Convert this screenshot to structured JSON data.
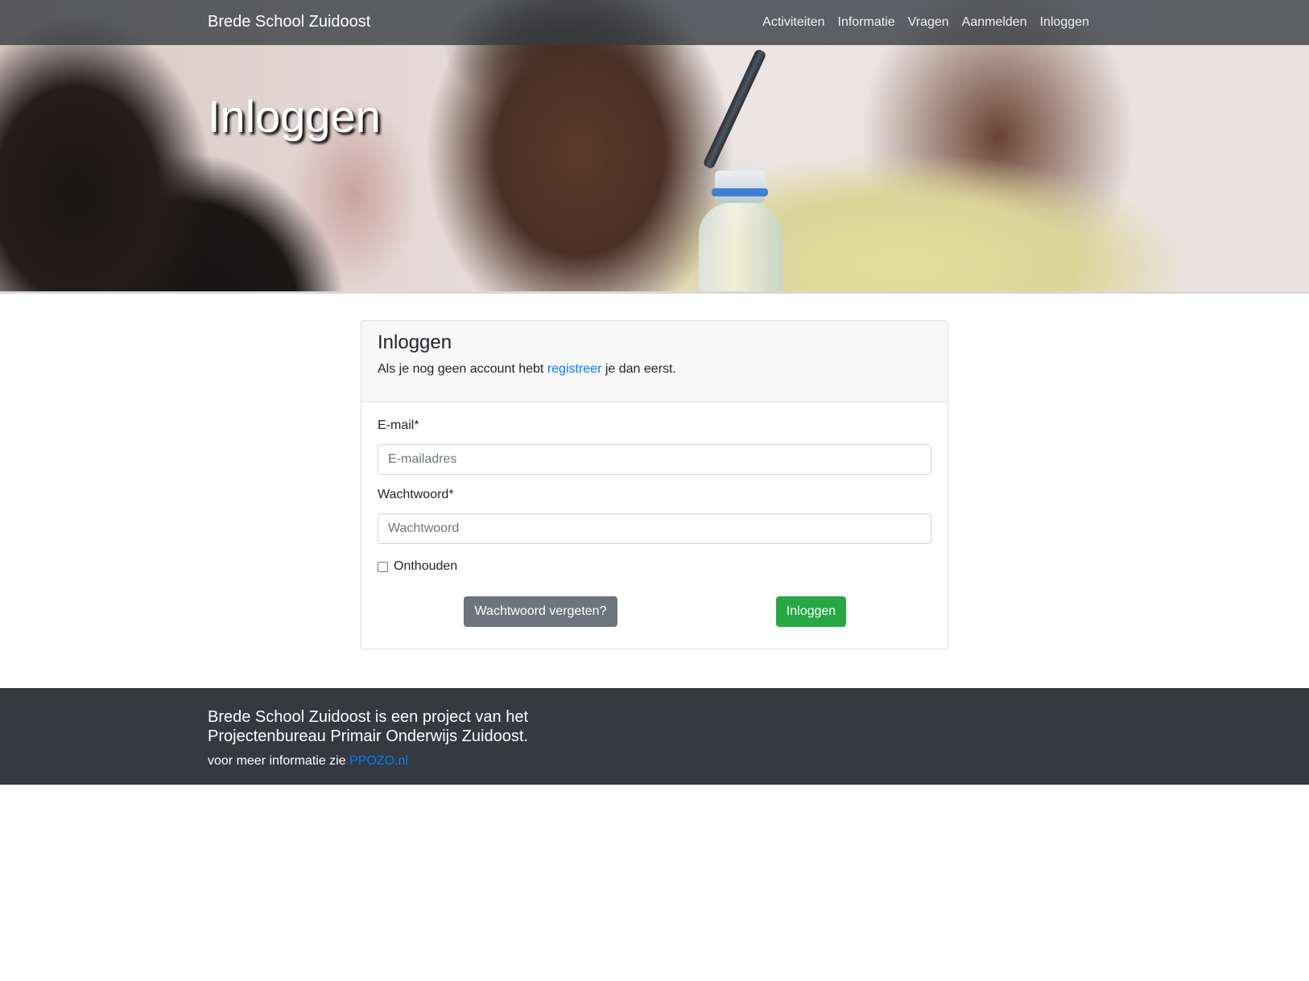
{
  "navbar": {
    "brand": "Brede School Zuidoost",
    "links": [
      "Activiteiten",
      "Informatie",
      "Vragen",
      "Aanmelden",
      "Inloggen"
    ]
  },
  "hero": {
    "title": "Inloggen"
  },
  "login_card": {
    "title": "Inloggen",
    "subtitle_before": "Als je nog geen account hebt ",
    "subtitle_link": "registreer",
    "subtitle_after": " je dan eerst.",
    "email_label": "E-mail*",
    "email_placeholder": "E-mailadres",
    "email_value": "",
    "password_label": "Wachtwoord*",
    "password_placeholder": "Wachtwoord",
    "password_value": "",
    "remember_label": "Onthouden",
    "remember_checked": false,
    "forgot_button": "Wachtwoord vergeten?",
    "submit_button": "Inloggen"
  },
  "footer": {
    "line1": "Brede School Zuidoost is een project van het",
    "line2": "Projectenbureau Primair Onderwijs Zuidoost.",
    "info_text": "voor meer informatie zie ",
    "info_link": "PPOZO.nl"
  },
  "colors": {
    "navbar_bg": "#343a40",
    "footer_bg": "#343a40",
    "link": "#007bff",
    "secondary_button": "#6c757d",
    "success_button": "#28a745",
    "card_header_bg": "#f7f7f7"
  }
}
